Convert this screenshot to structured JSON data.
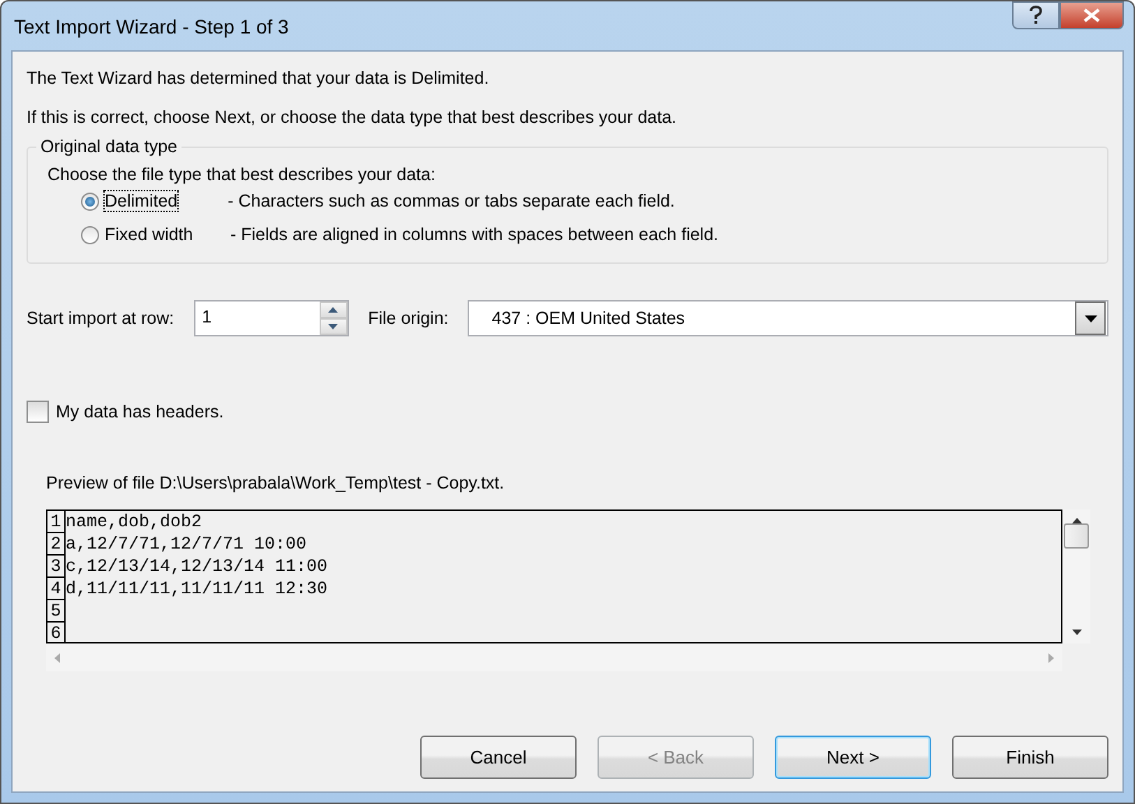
{
  "window": {
    "title": "Text Import Wizard - Step 1 of 3"
  },
  "intro": [
    "The Text Wizard has determined that your data is Delimited.",
    "If this is correct, choose Next, or choose the data type that best describes your data."
  ],
  "data_type": {
    "title": "Original data type",
    "prompt": "Choose the file type that best describes your data:",
    "options": [
      {
        "label": "Delimited",
        "description": "- Characters such as commas or tabs separate each field.",
        "selected": true
      },
      {
        "label": "Fixed width",
        "description": "- Fields are aligned in columns with spaces between each field.",
        "selected": false
      }
    ]
  },
  "start_row": {
    "label": "Start import at row:",
    "value": "1"
  },
  "file_origin": {
    "label": "File origin:",
    "value": "437 : OEM United States"
  },
  "headers_checkbox": {
    "label": "My data has headers.",
    "checked": false
  },
  "preview": {
    "label": "Preview of file D:\\Users\\prabala\\Work_Temp\\test - Copy.txt.",
    "lines": [
      {
        "number": "1",
        "text": "name,dob,dob2"
      },
      {
        "number": "2",
        "text": "a,12/7/71,12/7/71 10:00"
      },
      {
        "number": "3",
        "text": "c,12/13/14,12/13/14 11:00"
      },
      {
        "number": "4",
        "text": "d,11/11/11,11/11/11 12:30"
      },
      {
        "number": "5"
      },
      {
        "number": "6"
      }
    ]
  },
  "buttons": [
    {
      "label": "Cancel",
      "disabled": false,
      "default": false
    },
    {
      "label": "< Back",
      "disabled": true,
      "default": false
    },
    {
      "label": "Next >",
      "disabled": false,
      "default": true
    },
    {
      "label": "Finish",
      "disabled": false,
      "default": false
    }
  ]
}
